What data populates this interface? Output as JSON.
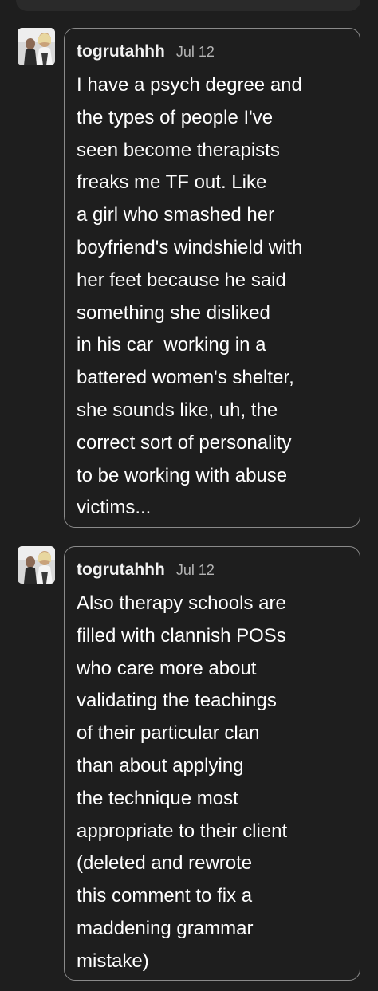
{
  "comments": [
    {
      "username": "togrutahhh",
      "date": "Jul 12",
      "lines": [
        "I have a psych degree and",
        "the types of people I've",
        "seen become therapists",
        "freaks me TF out. Like",
        "a girl who smashed her",
        "boyfriend's windshield with",
        "her feet because he said",
        "something she disliked",
        "in his car  working in a",
        "battered women's shelter,",
        "she sounds like, uh, the",
        "correct sort of personality",
        "to be working with abuse",
        "victims..."
      ]
    },
    {
      "username": "togrutahhh",
      "date": "Jul 12",
      "lines": [
        "Also therapy schools are",
        "filled with clannish POSs",
        "who care more about",
        "validating the teachings",
        "of their particular clan",
        "than about applying",
        "the technique most",
        "appropriate to their client",
        "(deleted and rewrote",
        "this comment to fix a",
        "maddening grammar",
        "mistake)"
      ]
    }
  ]
}
